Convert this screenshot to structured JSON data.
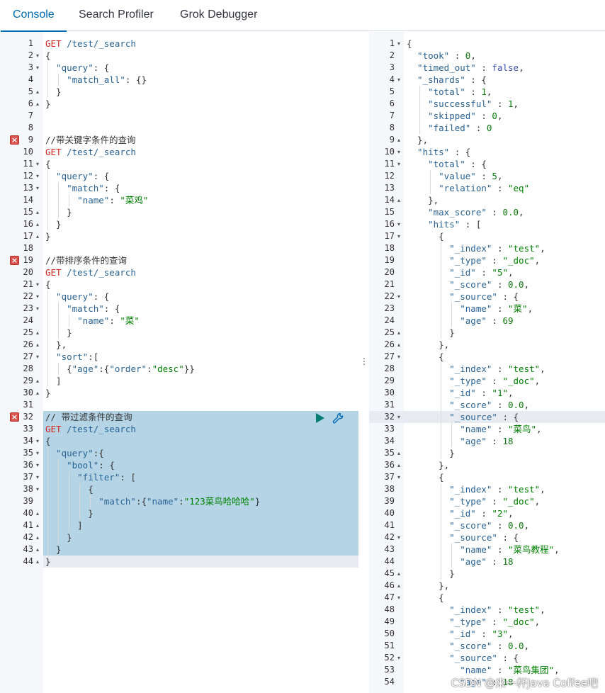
{
  "tabs": [
    {
      "label": "Console",
      "active": true
    },
    {
      "label": "Search Profiler",
      "active": false
    },
    {
      "label": "Grok Debugger",
      "active": false
    }
  ],
  "request_editor": {
    "error_lines": [
      9,
      19,
      32
    ],
    "selected_request_lines": [
      32,
      44
    ],
    "lines": [
      [
        {
          "t": "GET",
          "c": "method"
        },
        {
          "t": " /test/_search",
          "c": "url"
        }
      ],
      [
        {
          "t": "{",
          "c": "punc"
        }
      ],
      [
        {
          "t": "  \"query\"",
          "c": "key"
        },
        {
          "t": ": {",
          "c": "punc"
        }
      ],
      [
        {
          "t": "    \"match_all\"",
          "c": "key"
        },
        {
          "t": ": {}",
          "c": "punc"
        }
      ],
      [
        {
          "t": "  }",
          "c": "punc"
        }
      ],
      [
        {
          "t": "}",
          "c": "punc"
        }
      ],
      [],
      [],
      [
        {
          "t": "//带关键字条件的查询",
          "c": "comment"
        }
      ],
      [
        {
          "t": "GET",
          "c": "method"
        },
        {
          "t": " /test/_search",
          "c": "url"
        }
      ],
      [
        {
          "t": "{",
          "c": "punc"
        }
      ],
      [
        {
          "t": "  \"query\"",
          "c": "key"
        },
        {
          "t": ": {",
          "c": "punc"
        }
      ],
      [
        {
          "t": "    \"match\"",
          "c": "key"
        },
        {
          "t": ": {",
          "c": "punc"
        }
      ],
      [
        {
          "t": "      \"name\"",
          "c": "key"
        },
        {
          "t": ": ",
          "c": "punc"
        },
        {
          "t": "\"菜鸡\"",
          "c": "str"
        }
      ],
      [
        {
          "t": "    }",
          "c": "punc"
        }
      ],
      [
        {
          "t": "  }",
          "c": "punc"
        }
      ],
      [
        {
          "t": "}",
          "c": "punc"
        }
      ],
      [],
      [
        {
          "t": "//带排序条件的查询",
          "c": "comment"
        }
      ],
      [
        {
          "t": "GET",
          "c": "method"
        },
        {
          "t": " /test/_search",
          "c": "url"
        }
      ],
      [
        {
          "t": "{",
          "c": "punc"
        }
      ],
      [
        {
          "t": "  \"query\"",
          "c": "key"
        },
        {
          "t": ": {",
          "c": "punc"
        }
      ],
      [
        {
          "t": "    \"match\"",
          "c": "key"
        },
        {
          "t": ": {",
          "c": "punc"
        }
      ],
      [
        {
          "t": "      \"name\"",
          "c": "key"
        },
        {
          "t": ": ",
          "c": "punc"
        },
        {
          "t": "\"菜\"",
          "c": "str"
        }
      ],
      [
        {
          "t": "    }",
          "c": "punc"
        }
      ],
      [
        {
          "t": "  },",
          "c": "punc"
        }
      ],
      [
        {
          "t": "  \"sort\"",
          "c": "key"
        },
        {
          "t": ":[",
          "c": "punc"
        }
      ],
      [
        {
          "t": "    {",
          "c": "punc"
        },
        {
          "t": "\"age\"",
          "c": "key"
        },
        {
          "t": ":{",
          "c": "punc"
        },
        {
          "t": "\"order\"",
          "c": "key"
        },
        {
          "t": ":",
          "c": "punc"
        },
        {
          "t": "\"desc\"",
          "c": "str"
        },
        {
          "t": "}}",
          "c": "punc"
        }
      ],
      [
        {
          "t": "  ]",
          "c": "punc"
        }
      ],
      [
        {
          "t": "}",
          "c": "punc"
        }
      ],
      [],
      [
        {
          "t": "// 带过滤条件的查询",
          "c": "comment"
        }
      ],
      [
        {
          "t": "GET",
          "c": "method"
        },
        {
          "t": " /test/_search",
          "c": "url"
        }
      ],
      [
        {
          "t": "{",
          "c": "punc"
        }
      ],
      [
        {
          "t": "  \"query\"",
          "c": "key"
        },
        {
          "t": ":{",
          "c": "punc"
        }
      ],
      [
        {
          "t": "    \"bool\"",
          "c": "key"
        },
        {
          "t": ": {",
          "c": "punc"
        }
      ],
      [
        {
          "t": "      \"filter\"",
          "c": "key"
        },
        {
          "t": ": [",
          "c": "punc"
        }
      ],
      [
        {
          "t": "        {",
          "c": "punc"
        }
      ],
      [
        {
          "t": "          \"match\"",
          "c": "key"
        },
        {
          "t": ":{",
          "c": "punc"
        },
        {
          "t": "\"name\"",
          "c": "key"
        },
        {
          "t": ":",
          "c": "punc"
        },
        {
          "t": "\"123菜鸟哈哈哈\"",
          "c": "str"
        },
        {
          "t": "}",
          "c": "punc"
        }
      ],
      [
        {
          "t": "        }",
          "c": "punc"
        }
      ],
      [
        {
          "t": "      ]",
          "c": "punc"
        }
      ],
      [
        {
          "t": "    }",
          "c": "punc"
        }
      ],
      [
        {
          "t": "  }",
          "c": "punc"
        }
      ],
      [
        {
          "t": "}",
          "c": "punc"
        }
      ]
    ],
    "folds": {
      "2": "down",
      "3": "down",
      "5": "up",
      "6": "up",
      "11": "down",
      "12": "down",
      "13": "down",
      "15": "up",
      "16": "up",
      "17": "up",
      "21": "down",
      "22": "down",
      "23": "down",
      "25": "up",
      "26": "up",
      "27": "down",
      "29": "up",
      "30": "up",
      "34": "down",
      "35": "down",
      "36": "down",
      "37": "down",
      "38": "down",
      "40": "up",
      "41": "up",
      "42": "up",
      "43": "up",
      "44": "up"
    }
  },
  "response_viewer": {
    "current_line": 32,
    "lines": [
      [
        {
          "t": "{",
          "c": "punc"
        }
      ],
      [
        {
          "t": "  \"took\"",
          "c": "key"
        },
        {
          "t": " : ",
          "c": "punc"
        },
        {
          "t": "0",
          "c": "num"
        },
        {
          "t": ",",
          "c": "punc"
        }
      ],
      [
        {
          "t": "  \"timed_out\"",
          "c": "key"
        },
        {
          "t": " : ",
          "c": "punc"
        },
        {
          "t": "false",
          "c": "bool"
        },
        {
          "t": ",",
          "c": "punc"
        }
      ],
      [
        {
          "t": "  \"_shards\"",
          "c": "key"
        },
        {
          "t": " : {",
          "c": "punc"
        }
      ],
      [
        {
          "t": "    \"total\"",
          "c": "key"
        },
        {
          "t": " : ",
          "c": "punc"
        },
        {
          "t": "1",
          "c": "num"
        },
        {
          "t": ",",
          "c": "punc"
        }
      ],
      [
        {
          "t": "    \"successful\"",
          "c": "key"
        },
        {
          "t": " : ",
          "c": "punc"
        },
        {
          "t": "1",
          "c": "num"
        },
        {
          "t": ",",
          "c": "punc"
        }
      ],
      [
        {
          "t": "    \"skipped\"",
          "c": "key"
        },
        {
          "t": " : ",
          "c": "punc"
        },
        {
          "t": "0",
          "c": "num"
        },
        {
          "t": ",",
          "c": "punc"
        }
      ],
      [
        {
          "t": "    \"failed\"",
          "c": "key"
        },
        {
          "t": " : ",
          "c": "punc"
        },
        {
          "t": "0",
          "c": "num"
        }
      ],
      [
        {
          "t": "  },",
          "c": "punc"
        }
      ],
      [
        {
          "t": "  \"hits\"",
          "c": "key"
        },
        {
          "t": " : {",
          "c": "punc"
        }
      ],
      [
        {
          "t": "    \"total\"",
          "c": "key"
        },
        {
          "t": " : {",
          "c": "punc"
        }
      ],
      [
        {
          "t": "      \"value\"",
          "c": "key"
        },
        {
          "t": " : ",
          "c": "punc"
        },
        {
          "t": "5",
          "c": "num"
        },
        {
          "t": ",",
          "c": "punc"
        }
      ],
      [
        {
          "t": "      \"relation\"",
          "c": "key"
        },
        {
          "t": " : ",
          "c": "punc"
        },
        {
          "t": "\"eq\"",
          "c": "str"
        }
      ],
      [
        {
          "t": "    },",
          "c": "punc"
        }
      ],
      [
        {
          "t": "    \"max_score\"",
          "c": "key"
        },
        {
          "t": " : ",
          "c": "punc"
        },
        {
          "t": "0.0",
          "c": "num"
        },
        {
          "t": ",",
          "c": "punc"
        }
      ],
      [
        {
          "t": "    \"hits\"",
          "c": "key"
        },
        {
          "t": " : [",
          "c": "punc"
        }
      ],
      [
        {
          "t": "      {",
          "c": "punc"
        }
      ],
      [
        {
          "t": "        \"_index\"",
          "c": "key"
        },
        {
          "t": " : ",
          "c": "punc"
        },
        {
          "t": "\"test\"",
          "c": "str"
        },
        {
          "t": ",",
          "c": "punc"
        }
      ],
      [
        {
          "t": "        \"_type\"",
          "c": "key"
        },
        {
          "t": " : ",
          "c": "punc"
        },
        {
          "t": "\"_doc\"",
          "c": "str"
        },
        {
          "t": ",",
          "c": "punc"
        }
      ],
      [
        {
          "t": "        \"_id\"",
          "c": "key"
        },
        {
          "t": " : ",
          "c": "punc"
        },
        {
          "t": "\"5\"",
          "c": "str"
        },
        {
          "t": ",",
          "c": "punc"
        }
      ],
      [
        {
          "t": "        \"_score\"",
          "c": "key"
        },
        {
          "t": " : ",
          "c": "punc"
        },
        {
          "t": "0.0",
          "c": "num"
        },
        {
          "t": ",",
          "c": "punc"
        }
      ],
      [
        {
          "t": "        \"_source\"",
          "c": "key"
        },
        {
          "t": " : {",
          "c": "punc"
        }
      ],
      [
        {
          "t": "          \"name\"",
          "c": "key"
        },
        {
          "t": " : ",
          "c": "punc"
        },
        {
          "t": "\"菜\"",
          "c": "str"
        },
        {
          "t": ",",
          "c": "punc"
        }
      ],
      [
        {
          "t": "          \"age\"",
          "c": "key"
        },
        {
          "t": " : ",
          "c": "punc"
        },
        {
          "t": "69",
          "c": "num"
        }
      ],
      [
        {
          "t": "        }",
          "c": "punc"
        }
      ],
      [
        {
          "t": "      },",
          "c": "punc"
        }
      ],
      [
        {
          "t": "      {",
          "c": "punc"
        }
      ],
      [
        {
          "t": "        \"_index\"",
          "c": "key"
        },
        {
          "t": " : ",
          "c": "punc"
        },
        {
          "t": "\"test\"",
          "c": "str"
        },
        {
          "t": ",",
          "c": "punc"
        }
      ],
      [
        {
          "t": "        \"_type\"",
          "c": "key"
        },
        {
          "t": " : ",
          "c": "punc"
        },
        {
          "t": "\"_doc\"",
          "c": "str"
        },
        {
          "t": ",",
          "c": "punc"
        }
      ],
      [
        {
          "t": "        \"_id\"",
          "c": "key"
        },
        {
          "t": " : ",
          "c": "punc"
        },
        {
          "t": "\"1\"",
          "c": "str"
        },
        {
          "t": ",",
          "c": "punc"
        }
      ],
      [
        {
          "t": "        \"_score\"",
          "c": "key"
        },
        {
          "t": " : ",
          "c": "punc"
        },
        {
          "t": "0.0",
          "c": "num"
        },
        {
          "t": ",",
          "c": "punc"
        }
      ],
      [
        {
          "t": "        \"_source\"",
          "c": "key"
        },
        {
          "t": " : {",
          "c": "punc"
        }
      ],
      [
        {
          "t": "          \"name\"",
          "c": "key"
        },
        {
          "t": " : ",
          "c": "punc"
        },
        {
          "t": "\"菜鸟\"",
          "c": "str"
        },
        {
          "t": ",",
          "c": "punc"
        }
      ],
      [
        {
          "t": "          \"age\"",
          "c": "key"
        },
        {
          "t": " : ",
          "c": "punc"
        },
        {
          "t": "18",
          "c": "num"
        }
      ],
      [
        {
          "t": "        }",
          "c": "punc"
        }
      ],
      [
        {
          "t": "      },",
          "c": "punc"
        }
      ],
      [
        {
          "t": "      {",
          "c": "punc"
        }
      ],
      [
        {
          "t": "        \"_index\"",
          "c": "key"
        },
        {
          "t": " : ",
          "c": "punc"
        },
        {
          "t": "\"test\"",
          "c": "str"
        },
        {
          "t": ",",
          "c": "punc"
        }
      ],
      [
        {
          "t": "        \"_type\"",
          "c": "key"
        },
        {
          "t": " : ",
          "c": "punc"
        },
        {
          "t": "\"_doc\"",
          "c": "str"
        },
        {
          "t": ",",
          "c": "punc"
        }
      ],
      [
        {
          "t": "        \"_id\"",
          "c": "key"
        },
        {
          "t": " : ",
          "c": "punc"
        },
        {
          "t": "\"2\"",
          "c": "str"
        },
        {
          "t": ",",
          "c": "punc"
        }
      ],
      [
        {
          "t": "        \"_score\"",
          "c": "key"
        },
        {
          "t": " : ",
          "c": "punc"
        },
        {
          "t": "0.0",
          "c": "num"
        },
        {
          "t": ",",
          "c": "punc"
        }
      ],
      [
        {
          "t": "        \"_source\"",
          "c": "key"
        },
        {
          "t": " : {",
          "c": "punc"
        }
      ],
      [
        {
          "t": "          \"name\"",
          "c": "key"
        },
        {
          "t": " : ",
          "c": "punc"
        },
        {
          "t": "\"菜鸟教程\"",
          "c": "str"
        },
        {
          "t": ",",
          "c": "punc"
        }
      ],
      [
        {
          "t": "          \"age\"",
          "c": "key"
        },
        {
          "t": " : ",
          "c": "punc"
        },
        {
          "t": "18",
          "c": "num"
        }
      ],
      [
        {
          "t": "        }",
          "c": "punc"
        }
      ],
      [
        {
          "t": "      },",
          "c": "punc"
        }
      ],
      [
        {
          "t": "      {",
          "c": "punc"
        }
      ],
      [
        {
          "t": "        \"_index\"",
          "c": "key"
        },
        {
          "t": " : ",
          "c": "punc"
        },
        {
          "t": "\"test\"",
          "c": "str"
        },
        {
          "t": ",",
          "c": "punc"
        }
      ],
      [
        {
          "t": "        \"_type\"",
          "c": "key"
        },
        {
          "t": " : ",
          "c": "punc"
        },
        {
          "t": "\"_doc\"",
          "c": "str"
        },
        {
          "t": ",",
          "c": "punc"
        }
      ],
      [
        {
          "t": "        \"_id\"",
          "c": "key"
        },
        {
          "t": " : ",
          "c": "punc"
        },
        {
          "t": "\"3\"",
          "c": "str"
        },
        {
          "t": ",",
          "c": "punc"
        }
      ],
      [
        {
          "t": "        \"_score\"",
          "c": "key"
        },
        {
          "t": " : ",
          "c": "punc"
        },
        {
          "t": "0.0",
          "c": "num"
        },
        {
          "t": ",",
          "c": "punc"
        }
      ],
      [
        {
          "t": "        \"_source\"",
          "c": "key"
        },
        {
          "t": " : {",
          "c": "punc"
        }
      ],
      [
        {
          "t": "          \"name\"",
          "c": "key"
        },
        {
          "t": " : ",
          "c": "punc"
        },
        {
          "t": "\"菜鸟集团\"",
          "c": "str"
        },
        {
          "t": ",",
          "c": "punc"
        }
      ],
      [
        {
          "t": "          \"age\"",
          "c": "key"
        },
        {
          "t": " : ",
          "c": "punc"
        },
        {
          "t": "18",
          "c": "num"
        }
      ]
    ],
    "folds": {
      "1": "down",
      "4": "down",
      "9": "up",
      "10": "down",
      "11": "down",
      "14": "up",
      "16": "down",
      "17": "down",
      "22": "down",
      "25": "up",
      "26": "up",
      "27": "down",
      "32": "down",
      "35": "up",
      "36": "up",
      "37": "down",
      "42": "down",
      "45": "up",
      "46": "up",
      "47": "down",
      "52": "down"
    }
  },
  "actions": {
    "run_icon": "play-icon",
    "settings_icon": "wrench-icon"
  },
  "watermark": "CSDN @来一杯Java Coffee吧",
  "colors": {
    "accent": "#006bb4",
    "selection": "#b5d5e6",
    "error": "#d9534f",
    "run": "#017d73"
  }
}
